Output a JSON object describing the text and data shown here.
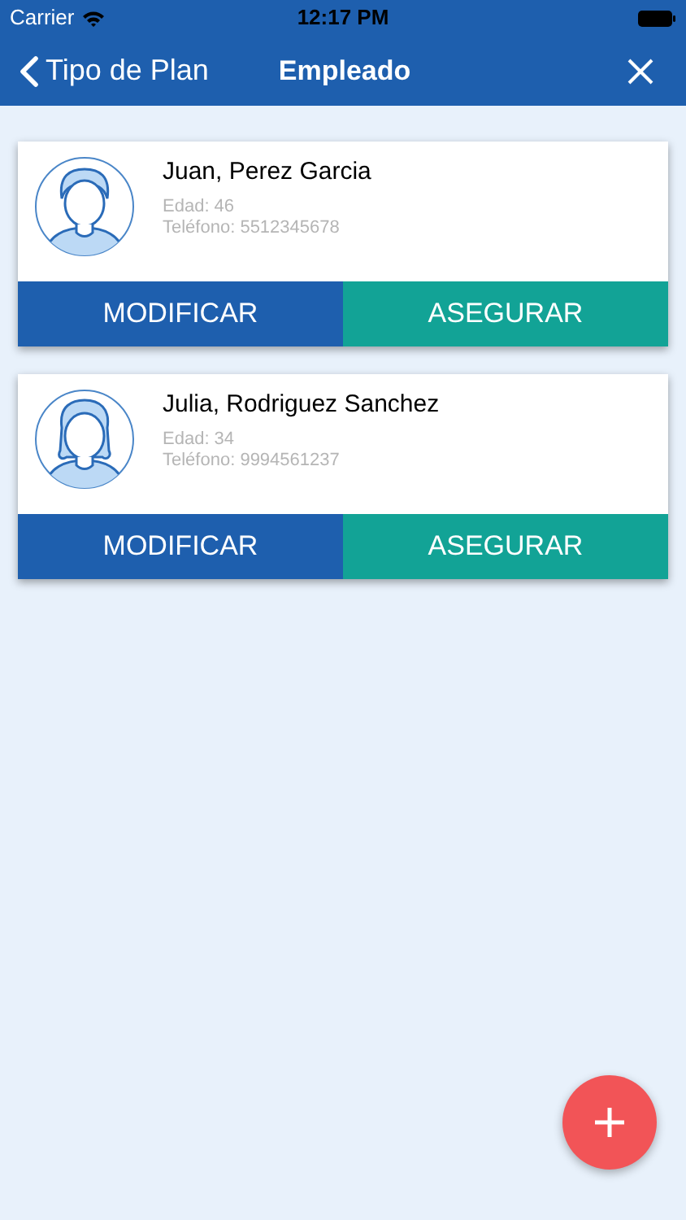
{
  "status_bar": {
    "carrier": "Carrier",
    "time": "12:17 PM"
  },
  "nav": {
    "back": "Tipo de Plan",
    "title": "Empleado"
  },
  "people": [
    {
      "kind": "male",
      "name": "Juan, Perez Garcia",
      "age": "Edad: 46",
      "phone": "Teléfono: 5512345678",
      "actions": [
        "MODIFICAR",
        "ASEGURAR"
      ]
    },
    {
      "kind": "female",
      "name": "Julia, Rodriguez Sanchez",
      "age": "Edad: 34",
      "phone": "Teléfono: 9994561237",
      "actions": [
        "MODIFICAR",
        "ASEGURAR"
      ]
    }
  ]
}
